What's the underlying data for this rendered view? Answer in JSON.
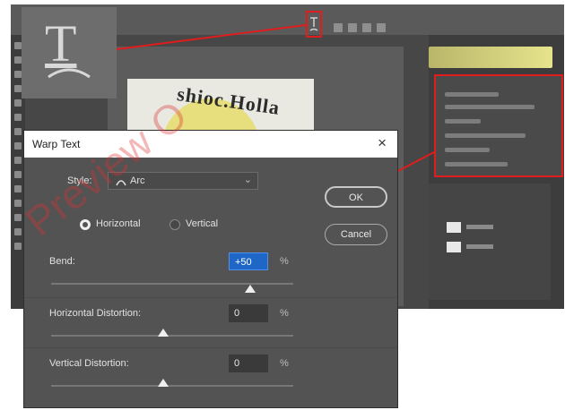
{
  "canvas": {
    "artwork_text": "shioc.Holla"
  },
  "dialog": {
    "title": "Warp Text",
    "close_glyph": "×",
    "style_label": "Style:",
    "style_value": "Arc",
    "style_icon": "arc-icon",
    "orientation": [
      {
        "label": "Horizontal",
        "selected": true
      },
      {
        "label": "Vertical",
        "selected": false
      }
    ],
    "ok_label": "OK",
    "cancel_label": "Cancel",
    "bend": {
      "label": "Bend:",
      "value": "+50",
      "unit": "%",
      "slider_fraction": 0.75
    },
    "h_distortion": {
      "label": "Horizontal Distortion:",
      "value": "0",
      "unit": "%",
      "slider_fraction": 0.5
    },
    "v_distortion": {
      "label": "Vertical Distortion:",
      "value": "0",
      "unit": "%",
      "slider_fraction": 0.5
    }
  },
  "toolbar": {
    "highlight_icon": "warp-text-icon"
  },
  "tool_zoom": {
    "glyph": "T",
    "icon": "warp-text-icon"
  },
  "watermark": {
    "text": "Preview O"
  },
  "colors": {
    "highlight": "#e01d1d",
    "focus_field": "#1f67c7",
    "canvas_circle": "#e7df7d"
  }
}
